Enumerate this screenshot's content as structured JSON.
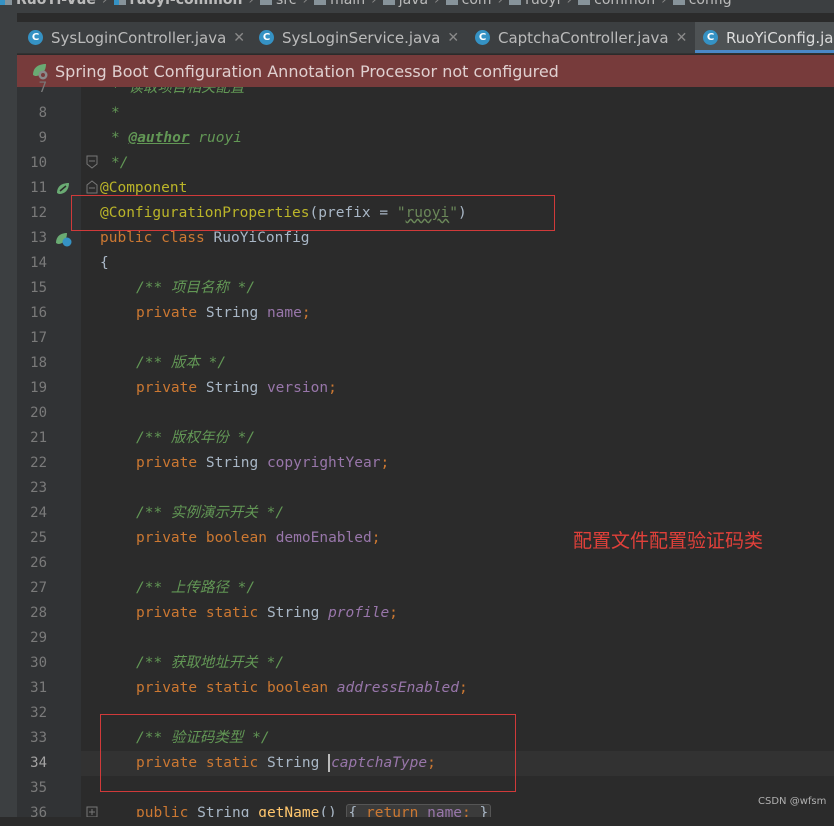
{
  "breadcrumb": {
    "items": [
      {
        "label": "RuoYi-Vue",
        "icon": "project-folder-icon"
      },
      {
        "label": "ruoyi-common",
        "icon": "module-folder-icon"
      },
      {
        "label": "src",
        "icon": "folder-icon"
      },
      {
        "label": "main",
        "icon": "folder-icon"
      },
      {
        "label": "java",
        "icon": "folder-icon"
      },
      {
        "label": "com",
        "icon": "folder-icon"
      },
      {
        "label": "ruoyi",
        "icon": "folder-icon"
      },
      {
        "label": "common",
        "icon": "folder-icon"
      },
      {
        "label": "config",
        "icon": "folder-icon"
      }
    ]
  },
  "tabs": [
    {
      "label": "SysLoginController.java",
      "active": false
    },
    {
      "label": "SysLoginService.java",
      "active": false
    },
    {
      "label": "CaptchaController.java",
      "active": false
    },
    {
      "label": "RuoYiConfig.java",
      "active": true
    }
  ],
  "banner": {
    "text": "Spring Boot Configuration Annotation Processor not configured"
  },
  "editor": {
    "line_numbers": [
      "7",
      "8",
      "9",
      "10",
      "11",
      "12",
      "13",
      "14",
      "15",
      "16",
      "17",
      "18",
      "19",
      "20",
      "21",
      "22",
      "23",
      "24",
      "25",
      "26",
      "27",
      "28",
      "29",
      "30",
      "31",
      "32",
      "33",
      "34",
      "35",
      "36"
    ],
    "current_line": "34",
    "code": {
      "l7": "* 读取项目相关配置",
      "l8": "*",
      "l9_star": "* ",
      "l9_tag": "@author",
      "l9_name": " ruoyi",
      "l10": "*/",
      "l11": "@Component",
      "l12_ann": "@ConfigurationProperties",
      "l12_a": "(prefix = ",
      "l12_q1": "\"",
      "l12_str": "ruoyi",
      "l12_q2": "\"",
      "l12_b": ")",
      "l13_kw": "public class ",
      "l13_name": "RuoYiConfig",
      "l14": "{",
      "c15": "/** 项目名称 */",
      "l16_kw": "private ",
      "l16_type": "String ",
      "l16_field": "name",
      "l16_semi": ";",
      "c18": "/** 版本 */",
      "l19_kw": "private ",
      "l19_type": "String ",
      "l19_field": "version",
      "l19_semi": ";",
      "c21": "/** 版权年份 */",
      "l22_kw": "private ",
      "l22_type": "String ",
      "l22_field": "copyrightYear",
      "l22_semi": ";",
      "c24": "/** 实例演示开关 */",
      "l25_kw": "private boolean ",
      "l25_field": "demoEnabled",
      "l25_semi": ";",
      "c27": "/** 上传路径 */",
      "l28_kw": "private static ",
      "l28_type": "String ",
      "l28_field": "profile",
      "l28_semi": ";",
      "c30": "/** 获取地址开关 */",
      "l31_kw": "private static boolean ",
      "l31_field": "addressEnabled",
      "l31_semi": ";",
      "c33": "/** 验证码类型 */",
      "l34_kw": "private static ",
      "l34_type": "String ",
      "l34_field": "captchaType",
      "l34_semi": ";",
      "l36_kw": "public ",
      "l36_type": "String ",
      "l36_fn": "getName",
      "l36_paren": "() ",
      "l36_open": "{ ",
      "l36_ret": "return ",
      "l36_field": "name",
      "l36_semi": "; ",
      "l36_close": "}"
    }
  },
  "annotation_note": "配置文件配置验证码类",
  "watermark": "CSDN @wfsm",
  "colors": {
    "editor_bg": "#2b2b2b",
    "keyword": "#cc7832",
    "annotation": "#bbb529",
    "string": "#6a8759",
    "field": "#9876aa",
    "comment": "#629755",
    "red_box": "#d03a3a",
    "banner_bg": "#773b3b"
  }
}
